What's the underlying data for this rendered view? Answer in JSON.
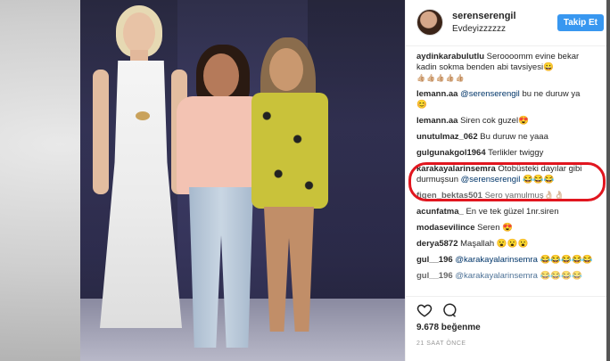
{
  "header": {
    "username": "serenserengil",
    "location": "Evdeyizzzzzz",
    "follow_label": "Takip Et"
  },
  "comments": [
    {
      "user": "aydinkarabulutlu",
      "text": "Seroooomm evine bekar kadin sokma benden abi tavsiyesi",
      "emoji": "😀",
      "reactions": "👍🏼👍🏼👍🏼👍🏼👍🏼"
    },
    {
      "user": "lemann.aa",
      "mention": "@serenserengil",
      "text": "bu ne duruw ya",
      "emoji": "😊"
    },
    {
      "user": "lemann.aa",
      "text": "Siren cok guzel",
      "emoji": "😍"
    },
    {
      "user": "unutulmaz_062",
      "text": "Bu duruw ne yaaa"
    },
    {
      "user": "gulgunakgol1964",
      "text": "Terlikler twiggy"
    },
    {
      "user": "karakayalarinsemra",
      "text": "Otobüsteki dayılar gibi durmuşsun",
      "mention": "@serenserengil",
      "emoji": "😂😂😂"
    },
    {
      "user": "figen_bektas501",
      "text": "Sero yamulmuş",
      "emoji": "👌🏼👌🏼"
    },
    {
      "user": "acunfatma_",
      "text": "En ve tek güzel 1nr.siren"
    },
    {
      "user": "modasevilince",
      "text": "Seren",
      "emoji": "😍"
    },
    {
      "user": "derya5872",
      "text": "Maşallah",
      "emoji": "😮😮😮"
    },
    {
      "user": "gul__196",
      "mention": "@karakayalarinsemra",
      "emoji": "😂😂😂😂😂"
    },
    {
      "user": "gul__196",
      "mention": "@karakayalarinsemra",
      "emoji": "😂😂😂😂"
    }
  ],
  "likes_text": "9.678 beğenme",
  "timestamp": "21 SAAT ÖNCE",
  "icons": [
    "heart-icon",
    "comment-icon"
  ],
  "colors": {
    "follow_button": "#3897f0",
    "highlight": "#e1161f",
    "mention": "#003569"
  }
}
